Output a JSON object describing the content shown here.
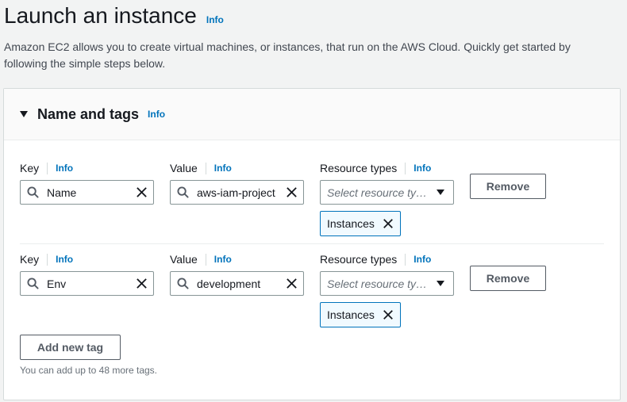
{
  "page": {
    "title": "Launch an instance",
    "title_info": "Info",
    "description": "Amazon EC2 allows you to create virtual machines, or instances, that run on the AWS Cloud. Quickly get started by following the simple steps below."
  },
  "section": {
    "title": "Name and tags",
    "info": "Info",
    "tags": [
      {
        "key_label": "Key",
        "key_info": "Info",
        "key_value": "Name",
        "value_label": "Value",
        "value_info": "Info",
        "value_value": "aws-iam-project",
        "resource_label": "Resource types",
        "resource_info": "Info",
        "resource_placeholder": "Select resource ty…",
        "resource_token": "Instances",
        "remove_label": "Remove"
      },
      {
        "key_label": "Key",
        "key_info": "Info",
        "key_value": "Env",
        "value_label": "Value",
        "value_info": "Info",
        "value_value": "development",
        "resource_label": "Resource types",
        "resource_info": "Info",
        "resource_placeholder": "Select resource ty…",
        "resource_token": "Instances",
        "remove_label": "Remove"
      }
    ],
    "add_button": "Add new tag",
    "hint": "You can add up to 48 more tags."
  },
  "colors": {
    "link": "#0073bb",
    "token_border": "#0073bb",
    "token_bg": "#f1faff",
    "page_bg": "#f2f3f3"
  },
  "icons": [
    "search-icon",
    "clear-icon",
    "dropdown-caret-icon",
    "remove-token-icon",
    "collapse-caret-icon"
  ]
}
